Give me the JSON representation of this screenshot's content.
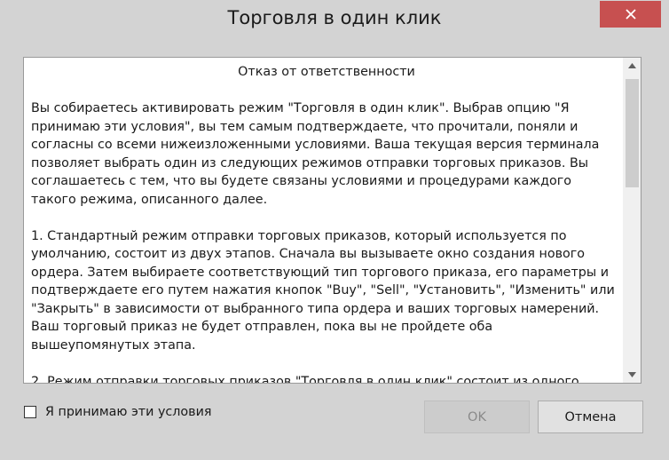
{
  "window": {
    "title": "Торговля в один клик",
    "close_icon": "close-icon"
  },
  "disclaimer": {
    "heading": "Отказ от ответственности",
    "paragraphs": [
      "Вы собираетесь активировать режим \"Торговля в один клик\". Выбрав опцию \"Я\nпринимаю эти условия\", вы тем самым подтверждаете, что прочитали, поняли и\nсогласны со всеми нижеизложенными условиями. Ваша текущая версия терминала\nпозволяет выбрать один из следующих режимов отправки торговых приказов. Вы\nсоглашаетесь с тем, что вы будете связаны условиями и процедурами каждого\nтакого режима, описанного далее.",
      "1. Стандартный режим отправки торговых приказов, который используется по\nумолчанию, состоит из двух этапов. Сначала вы вызываете окно создания нового\nордера. Затем выбираете соответствующий тип торгового приказа, его параметры и\nподтверждаете его путем нажатия кнопок \"Buy\", \"Sell\", \"Установить\", \"Изменить\" или\n\"Закрыть\" в зависимости от выбранного типа ордера и ваших торговых намерений.\nВаш торговый приказ не будет отправлен, пока вы не пройдете оба\nвышеупомянутых этапа.",
      "2. Режим отправки торговых приказов \"Торговля в один клик\" состоит из одного"
    ]
  },
  "accept": {
    "label": "Я принимаю эти условия",
    "checked": false
  },
  "buttons": {
    "ok_label": "OK",
    "ok_enabled": false,
    "cancel_label": "Отмена"
  },
  "colors": {
    "close_button": "#c75050",
    "window_background": "#d3d3d3"
  }
}
